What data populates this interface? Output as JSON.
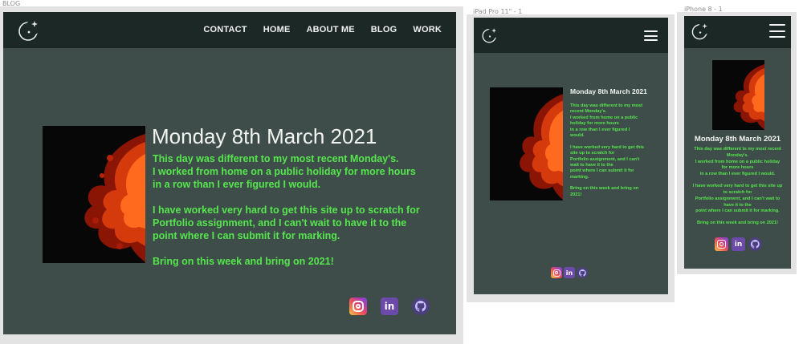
{
  "frames": {
    "blog": {
      "label": "BLOG"
    },
    "ipad": {
      "label": "iPad Pro 11\" - 1"
    },
    "iphone": {
      "label": "iPhone 8 - 1"
    }
  },
  "nav": {
    "items": [
      "CONTACT",
      "HOME",
      "ABOUT ME",
      "BLOG",
      "WORK"
    ]
  },
  "post": {
    "title": "Monday 8th March 2021",
    "desktop_lines": [
      "This day was different to my most recent Monday's.",
      "I worked from home on a public holiday for more hours",
      "in a row than I ever figured I would.",
      "",
      "I have worked very hard to get this site up to scratch for",
      "Portfolio assignment, and I can't wait to have it to the",
      "point where I can submit it for marking.",
      "",
      "Bring on this week and bring on 2021!"
    ],
    "ipad_lines": [
      "This day was different to my most",
      "recent Monday's.",
      "I worked from home on a public",
      "holiday for more hours",
      "in a row than I ever figured I",
      "would.",
      "",
      "I have worked very hard to get this",
      "site up to scratch for",
      "Portfolio assignment, and I can't",
      "wait to have it to the",
      "point where I can submit it for",
      "marking.",
      "",
      "Bring on this week and bring on",
      "2021!"
    ],
    "iphone_lines": [
      "This day was different to my most recent",
      "Monday's.",
      "I worked from home on a public holiday",
      "for more hours",
      "in a row than I ever figured I would.",
      "",
      "I have worked very hard to get this site up",
      "to scratch for",
      "Portfolio assignment, and I can't wait to",
      "have it to the",
      "point where I can submit it for marking.",
      "",
      "Bring on this week and bring on 2021!"
    ]
  },
  "social": {
    "linkedin_text": "in",
    "icons": [
      "instagram-icon",
      "linkedin-icon",
      "github-icon"
    ]
  },
  "colors": {
    "background": "#3f4d4a",
    "navbar": "#1b2826",
    "accent_green": "#55e64d",
    "title_white": "#f1f4f1"
  }
}
